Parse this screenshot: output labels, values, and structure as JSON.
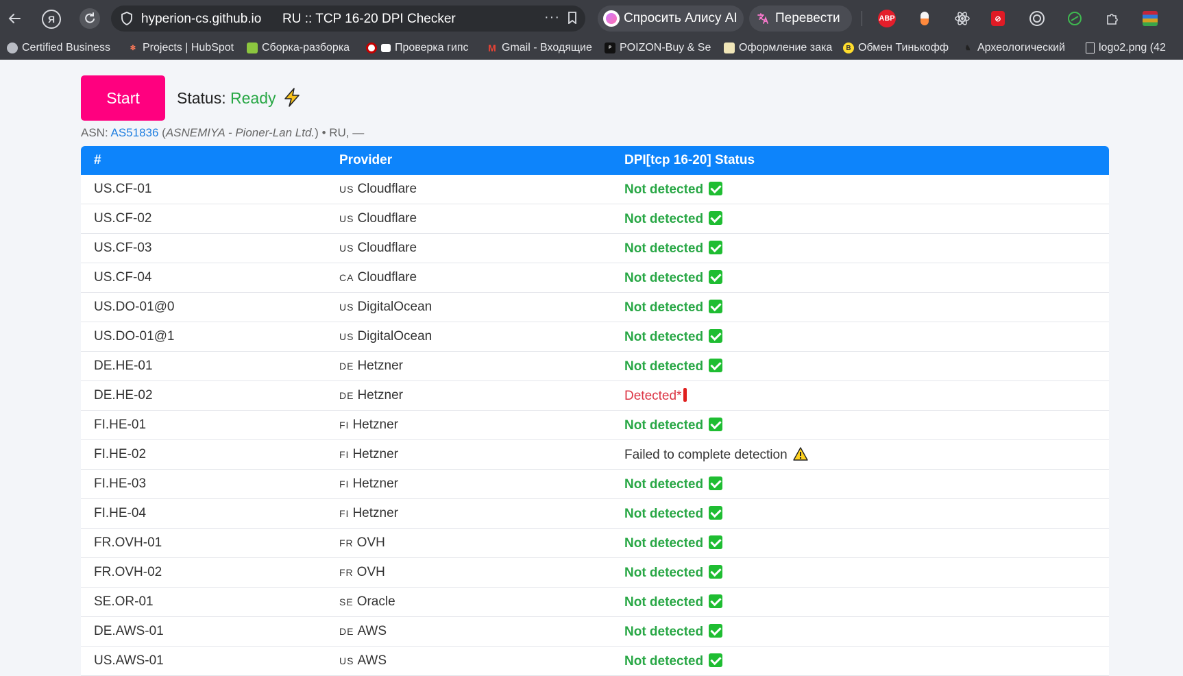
{
  "browser": {
    "host": "hyperion-cs.github.io",
    "page_title": "RU :: TCP 16-20 DPI Checker",
    "alice_label": "Спросить Алису AI",
    "translate_label": "Перевести",
    "ext_abp_label": "ABP",
    "bookmarks": [
      {
        "label": "Certified Business"
      },
      {
        "label": "Projects | HubSpot"
      },
      {
        "label": "Сборка-разборка"
      },
      {
        "label": "Проверка гипс"
      },
      {
        "label": "Gmail - Входящие"
      },
      {
        "label": "POIZON-Buy & Se"
      },
      {
        "label": "Оформление зака"
      },
      {
        "label": "Обмен Тинькофф"
      },
      {
        "label": "Археологический"
      },
      {
        "label": "logo2.png (42"
      }
    ]
  },
  "page": {
    "start_label": "Start",
    "status_label": "Status:",
    "status_value": "Ready",
    "asn_prefix": "ASN:",
    "asn_link": "AS51836",
    "asn_org": "ASNEMIYA - Pioner-Lan Ltd.",
    "asn_suffix": "• RU, —"
  },
  "table": {
    "headers": [
      "#",
      "Provider",
      "DPI[tcp 16-20] Status"
    ],
    "rows": [
      {
        "id": "US.CF-01",
        "cc": "US",
        "provider": "Cloudflare",
        "status": "Not detected",
        "kind": "ok"
      },
      {
        "id": "US.CF-02",
        "cc": "US",
        "provider": "Cloudflare",
        "status": "Not detected",
        "kind": "ok"
      },
      {
        "id": "US.CF-03",
        "cc": "US",
        "provider": "Cloudflare",
        "status": "Not detected",
        "kind": "ok"
      },
      {
        "id": "US.CF-04",
        "cc": "CA",
        "provider": "Cloudflare",
        "status": "Not detected",
        "kind": "ok"
      },
      {
        "id": "US.DO-01@0",
        "cc": "US",
        "provider": "DigitalOcean",
        "status": "Not detected",
        "kind": "ok"
      },
      {
        "id": "US.DO-01@1",
        "cc": "US",
        "provider": "DigitalOcean",
        "status": "Not detected",
        "kind": "ok"
      },
      {
        "id": "DE.HE-01",
        "cc": "DE",
        "provider": "Hetzner",
        "status": "Not detected",
        "kind": "ok"
      },
      {
        "id": "DE.HE-02",
        "cc": "DE",
        "provider": "Hetzner",
        "status": "Detected*",
        "kind": "bad"
      },
      {
        "id": "FI.HE-01",
        "cc": "FI",
        "provider": "Hetzner",
        "status": "Not detected",
        "kind": "ok"
      },
      {
        "id": "FI.HE-02",
        "cc": "FI",
        "provider": "Hetzner",
        "status": "Failed to complete detection",
        "kind": "fail"
      },
      {
        "id": "FI.HE-03",
        "cc": "FI",
        "provider": "Hetzner",
        "status": "Not detected",
        "kind": "ok"
      },
      {
        "id": "FI.HE-04",
        "cc": "FI",
        "provider": "Hetzner",
        "status": "Not detected",
        "kind": "ok"
      },
      {
        "id": "FR.OVH-01",
        "cc": "FR",
        "provider": "OVH",
        "status": "Not detected",
        "kind": "ok"
      },
      {
        "id": "FR.OVH-02",
        "cc": "FR",
        "provider": "OVH",
        "status": "Not detected",
        "kind": "ok"
      },
      {
        "id": "SE.OR-01",
        "cc": "SE",
        "provider": "Oracle",
        "status": "Not detected",
        "kind": "ok"
      },
      {
        "id": "DE.AWS-01",
        "cc": "DE",
        "provider": "AWS",
        "status": "Not detected",
        "kind": "ok"
      },
      {
        "id": "US.AWS-01",
        "cc": "US",
        "provider": "AWS",
        "status": "Not detected",
        "kind": "ok"
      }
    ]
  }
}
